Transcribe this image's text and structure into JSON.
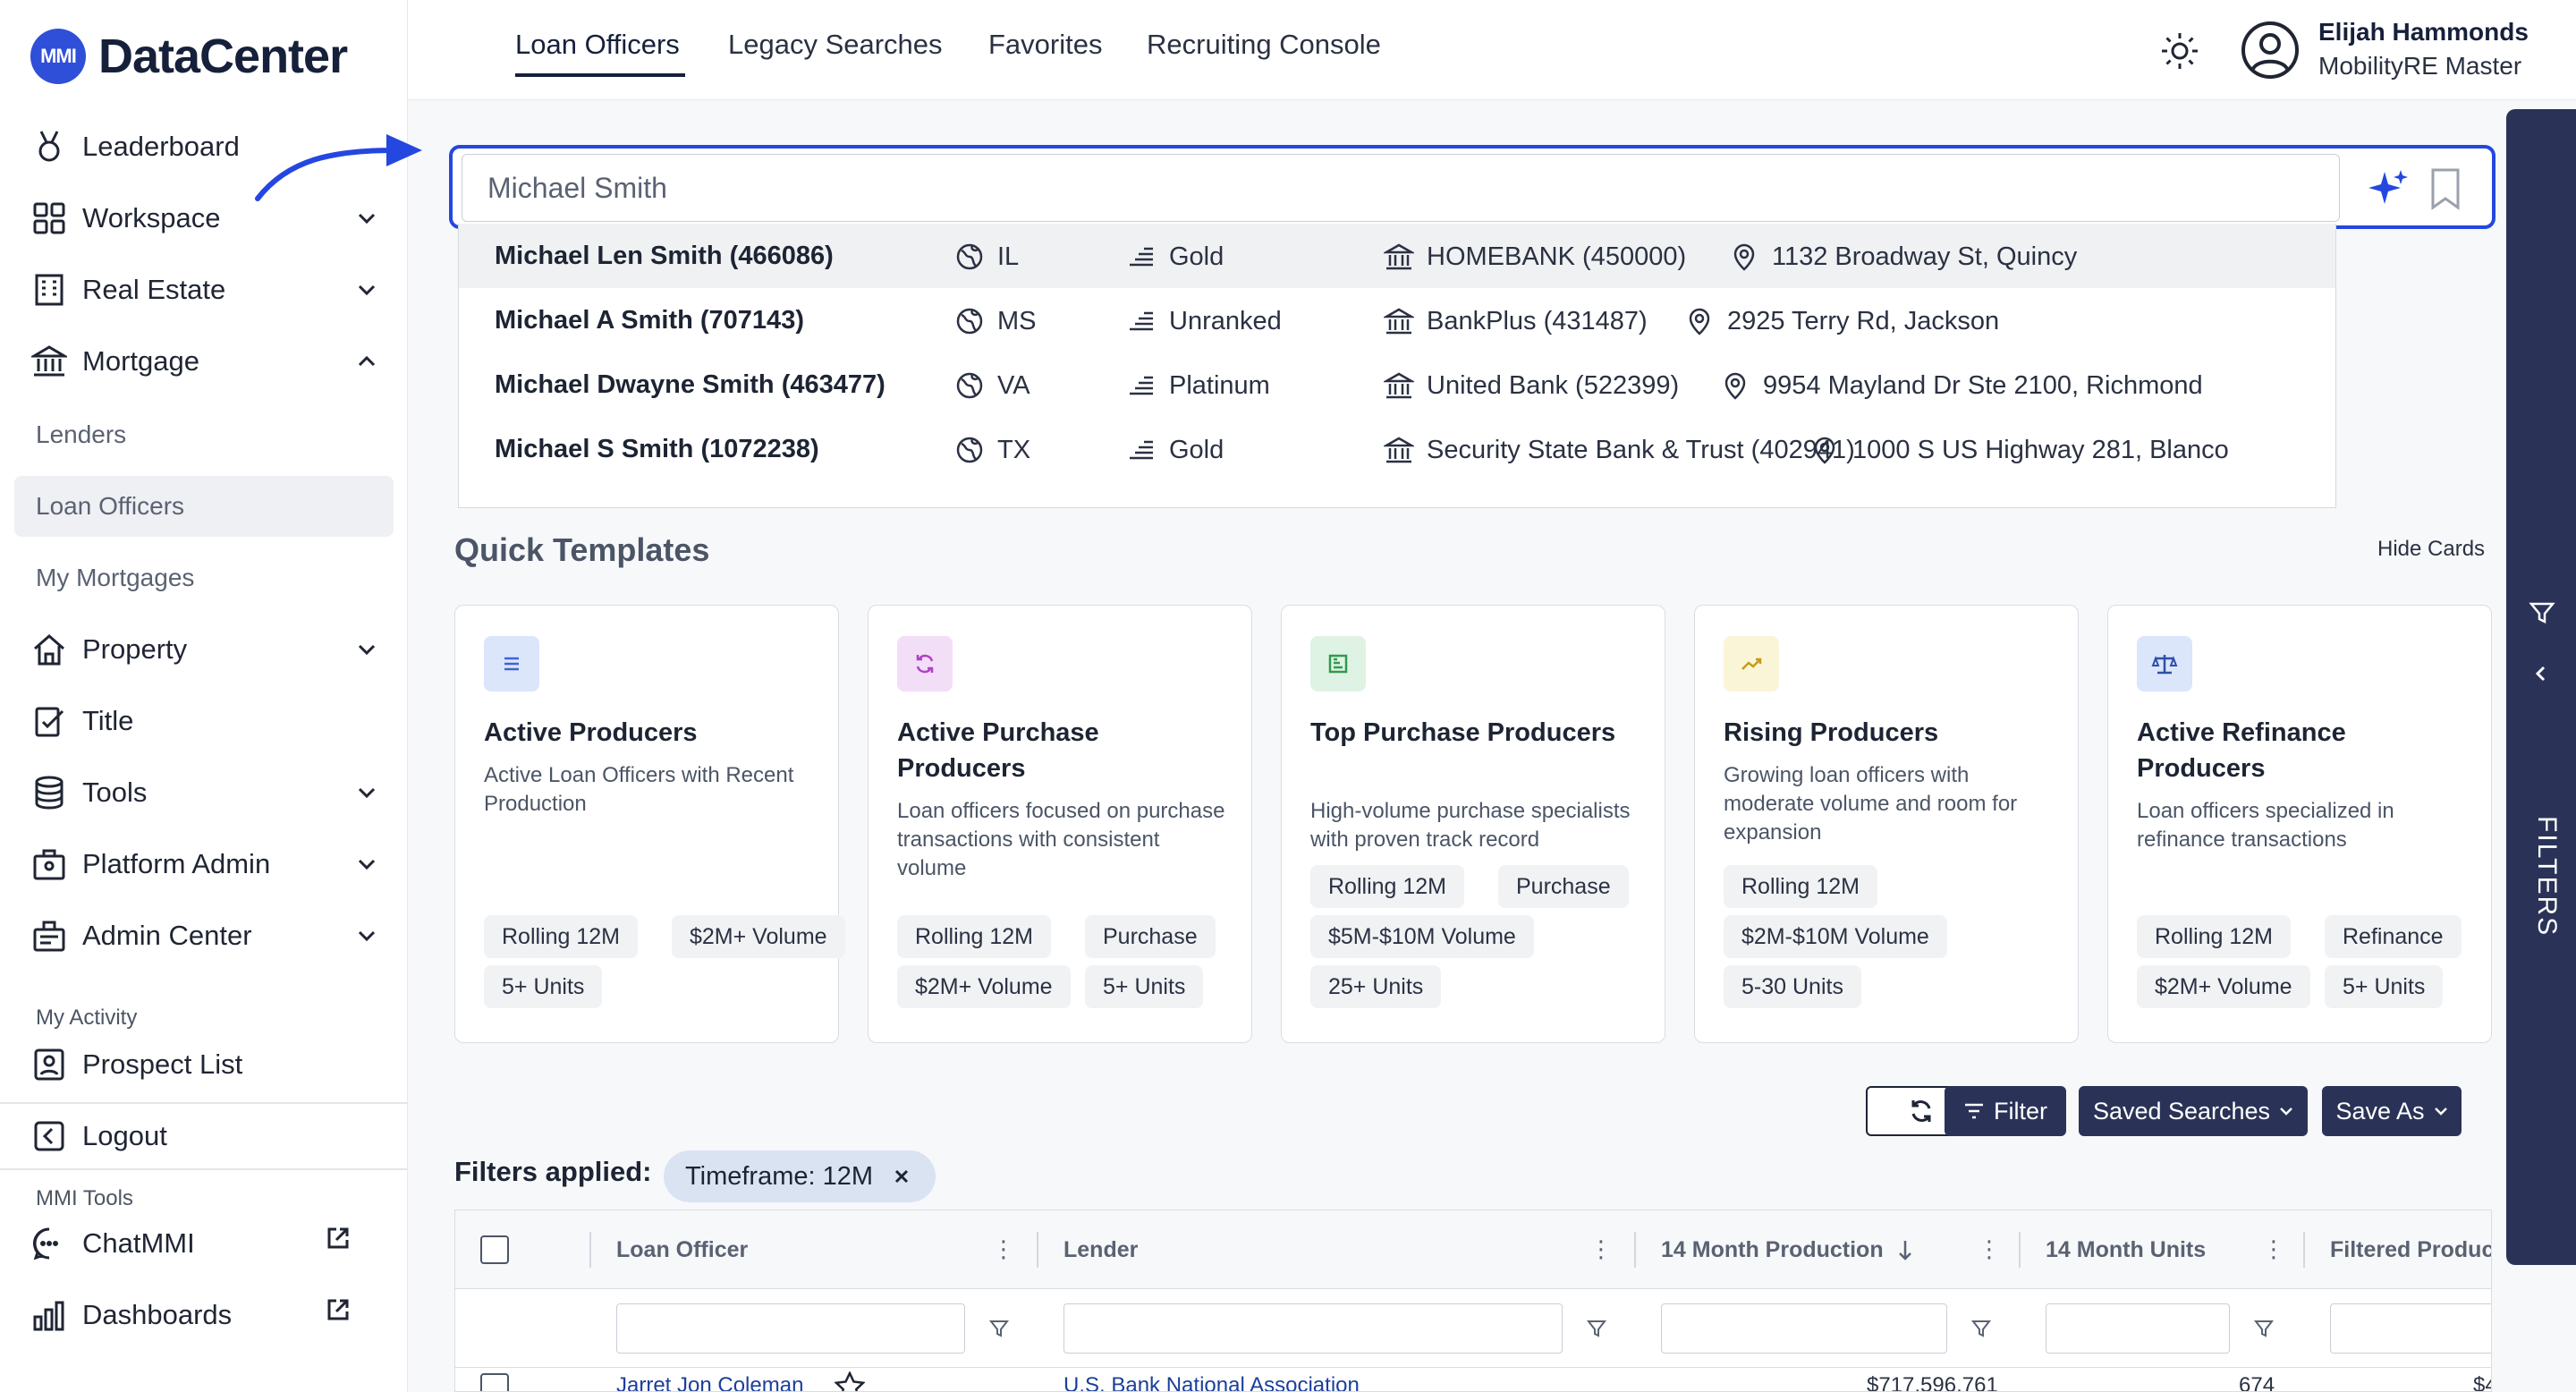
{
  "app": {
    "logo_badge": "MMI",
    "logo_text": "DataCenter"
  },
  "sidebar": {
    "items": [
      {
        "label": "Leaderboard"
      },
      {
        "label": "Workspace"
      },
      {
        "label": "Real Estate"
      },
      {
        "label": "Mortgage"
      }
    ],
    "mortgage_sub": [
      {
        "label": "Lenders"
      },
      {
        "label": "Loan Officers"
      },
      {
        "label": "My Mortgages"
      }
    ],
    "items2": [
      {
        "label": "Property"
      },
      {
        "label": "Title"
      },
      {
        "label": "Tools"
      },
      {
        "label": "Platform Admin"
      },
      {
        "label": "Admin Center"
      }
    ],
    "my_activity_label": "My Activity",
    "prospect_list": "Prospect List",
    "logout": "Logout",
    "mmi_tools_label": "MMI Tools",
    "chatmmi": "ChatMMI",
    "dashboards": "Dashboards"
  },
  "topnav": {
    "tabs": [
      {
        "label": "Loan Officers"
      },
      {
        "label": "Legacy Searches"
      },
      {
        "label": "Favorites"
      },
      {
        "label": "Recruiting Console"
      }
    ],
    "user_name": "Elijah Hammonds",
    "user_role": "MobilityRE Master"
  },
  "search": {
    "value": "Michael Smith",
    "results": [
      {
        "name": "Michael Len Smith (466086)",
        "state": "IL",
        "rank": "Gold",
        "bank": "HOMEBANK (450000)",
        "address": "1132 Broadway St, Quincy"
      },
      {
        "name": "Michael A Smith (707143)",
        "state": "MS",
        "rank": "Unranked",
        "bank": "BankPlus (431487)",
        "address": "2925 Terry Rd, Jackson"
      },
      {
        "name": "Michael Dwayne Smith (463477)",
        "state": "VA",
        "rank": "Platinum",
        "bank": "United Bank (522399)",
        "address": "9954 Mayland Dr Ste 2100, Richmond"
      },
      {
        "name": "Michael S Smith (1072238)",
        "state": "TX",
        "rank": "Gold",
        "bank": "Security State Bank & Trust (402941)",
        "address": "1000 S US Highway 281, Blanco"
      }
    ]
  },
  "templates": {
    "title": "Quick Templates",
    "hide_label": "Hide Cards",
    "cards": [
      {
        "title": "Active Producers",
        "desc": "Active Loan Officers with Recent Production",
        "pills": [
          "Rolling 12M",
          "$2M+ Volume",
          "5+ Units"
        ],
        "color": "#dbe6fb",
        "icon_color": "#3f63d6",
        "icon": "list-icon"
      },
      {
        "title": "Active Purchase Producers",
        "desc": "Loan officers focused on purchase transactions with consistent volume",
        "pills": [
          "Rolling 12M",
          "Purchase",
          "$2M+ Volume",
          "5+ Units"
        ],
        "color": "#f3def7",
        "icon_color": "#b040c8",
        "icon": "refresh-icon"
      },
      {
        "title": "Top Purchase Producers",
        "desc": "High-volume purchase specialists with proven track record",
        "pills": [
          "Rolling 12M",
          "Purchase",
          "$5M-$10M Volume",
          "25+ Units"
        ],
        "color": "#dff3e4",
        "icon_color": "#2f9a4e",
        "icon": "chart-icon"
      },
      {
        "title": "Rising Producers",
        "desc": "Growing loan officers with moderate volume and room for expansion",
        "pills": [
          "Rolling 12M",
          "$2M-$10M Volume",
          "5-30 Units"
        ],
        "color": "#fbf5d8",
        "icon_color": "#c79a18",
        "icon": "trend-icon"
      },
      {
        "title": "Active Refinance Producers",
        "desc": "Loan officers specialized in refinance transactions",
        "pills": [
          "Rolling 12M",
          "Refinance",
          "$2M+ Volume",
          "5+ Units"
        ],
        "color": "#dbe6fb",
        "icon_color": "#2f4fa8",
        "icon": "scale-icon"
      }
    ]
  },
  "actions": {
    "filter": "Filter",
    "saved_searches": "Saved Searches",
    "save_as": "Save As"
  },
  "filters_applied": {
    "label": "Filters applied:",
    "chip": "Timeframe: 12M"
  },
  "grid": {
    "columns": [
      "Loan Officer",
      "Lender",
      "14 Month Production",
      "14 Month Units",
      "Filtered Produc"
    ],
    "rows": [
      {
        "officer": "Jarret Jon Coleman",
        "lender": "U.S. Bank National Association",
        "production": "$717,596,761",
        "units": "674",
        "filtered": "$4"
      }
    ]
  },
  "rail": {
    "label": "FILTERS"
  },
  "colors": {
    "accent": "#2447e0",
    "dark": "#2a3357"
  }
}
